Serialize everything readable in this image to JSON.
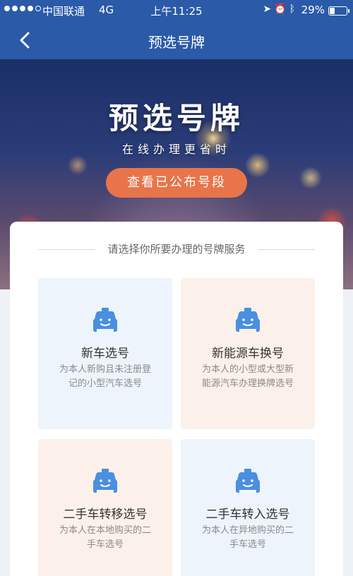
{
  "status_bar": {
    "carrier": "中国联通",
    "network": "4G",
    "time": "上午11:25",
    "battery_pct": "29%",
    "battery_level": 0.29,
    "signal_bars_filled": 4,
    "icons": [
      "location-icon",
      "alarm-icon",
      "bluetooth-icon"
    ]
  },
  "nav": {
    "back_icon": "chevron-left-icon",
    "title": "预选号牌"
  },
  "hero": {
    "title": "预选号牌",
    "subtitle": "在线办理更省时",
    "button_label": "查看已公布号段",
    "button_color": "#e8744a"
  },
  "services": {
    "heading": "请选择你所要办理的号牌服务",
    "icon": "car-icon",
    "icon_color": "#4a8fe0",
    "items": [
      {
        "title": "新车选号",
        "desc": "为本人新购且未注册登记的小型汽车选号"
      },
      {
        "title": "新能源车换号",
        "desc": "为本人的小型或大型新能源汽车办理换牌选号"
      },
      {
        "title": "二手车转移选号",
        "desc": "为本人在本地购买的二手车选号"
      },
      {
        "title": "二手车转入选号",
        "desc": "为本人在异地购买的二手车选号"
      }
    ]
  },
  "colors": {
    "header_blue": "#2a5aa8",
    "tile_blue": "#eef4fb",
    "tile_peach": "#fcf1ea"
  }
}
